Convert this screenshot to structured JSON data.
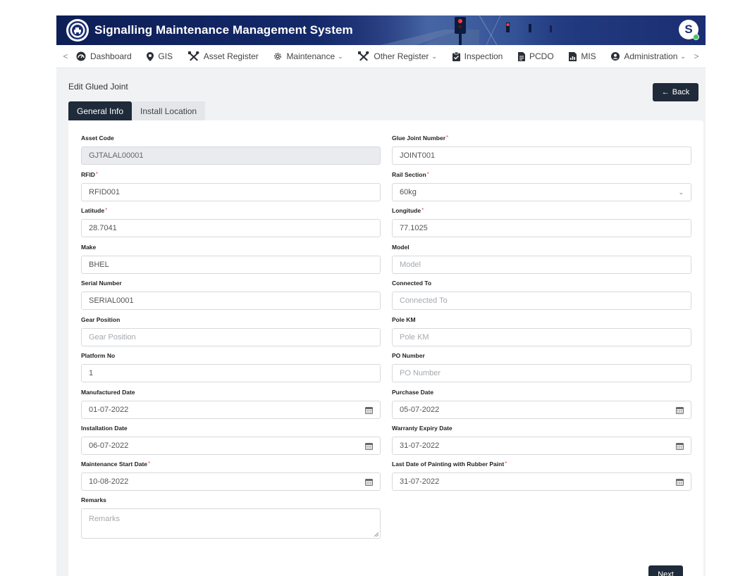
{
  "app": {
    "title": "Signalling Maintenance Management System",
    "avatar_initial": "S"
  },
  "nav": {
    "prev_arrow": "<",
    "next_arrow": ">",
    "items": [
      {
        "label": "Dashboard",
        "icon": "dashboard-gauge-icon",
        "dropdown": false
      },
      {
        "label": "GIS",
        "icon": "map-pin-icon",
        "dropdown": false
      },
      {
        "label": "Asset Register",
        "icon": "tools-icon",
        "dropdown": false
      },
      {
        "label": "Maintenance",
        "icon": "gear-icon",
        "dropdown": true
      },
      {
        "label": "Other Register",
        "icon": "tools-icon",
        "dropdown": true
      },
      {
        "label": "Inspection",
        "icon": "clipboard-check-icon",
        "dropdown": false
      },
      {
        "label": "PCDO",
        "icon": "document-icon",
        "dropdown": false
      },
      {
        "label": "MIS",
        "icon": "report-icon",
        "dropdown": false
      },
      {
        "label": "Administration",
        "icon": "user-circle-icon",
        "dropdown": true
      }
    ],
    "chevron": "⌄"
  },
  "page": {
    "title": "Edit Glued Joint",
    "back_label": "Back",
    "back_arrow": "←",
    "tabs": [
      {
        "label": "General Info",
        "active": true
      },
      {
        "label": "Install Location",
        "active": false
      }
    ],
    "next_label": "Next"
  },
  "form": {
    "asset_code": {
      "label": "Asset Code",
      "value": "GJTALAL00001",
      "placeholder": "",
      "required": false
    },
    "glue_joint_number": {
      "label": "Glue Joint Number",
      "value": "JOINT001",
      "placeholder": "",
      "required": true
    },
    "rfid": {
      "label": "RFID",
      "value": "RFID001",
      "placeholder": "",
      "required": true
    },
    "rail_section": {
      "label": "Rail Section",
      "value": "60kg",
      "placeholder": "",
      "required": true
    },
    "latitude": {
      "label": "Latitude",
      "value": "28.7041",
      "placeholder": "",
      "required": true
    },
    "longitude": {
      "label": "Longitude",
      "value": "77.1025",
      "placeholder": "",
      "required": true
    },
    "make": {
      "label": "Make",
      "value": "BHEL",
      "placeholder": "",
      "required": false
    },
    "model": {
      "label": "Model",
      "value": "",
      "placeholder": "Model",
      "required": false
    },
    "serial_number": {
      "label": "Serial Number",
      "value": "SERIAL0001",
      "placeholder": "",
      "required": false
    },
    "connected_to": {
      "label": "Connected To",
      "value": "",
      "placeholder": "Connected To",
      "required": false
    },
    "gear_position": {
      "label": "Gear Position",
      "value": "",
      "placeholder": "Gear Position",
      "required": false
    },
    "pole_km": {
      "label": "Pole KM",
      "value": "",
      "placeholder": "Pole KM",
      "required": false
    },
    "platform_no": {
      "label": "Platform No",
      "value": "1",
      "placeholder": "",
      "required": false
    },
    "po_number": {
      "label": "PO Number",
      "value": "",
      "placeholder": "PO Number",
      "required": false
    },
    "manufactured_date": {
      "label": "Manufactured Date",
      "value": "01-07-2022",
      "placeholder": "",
      "required": false
    },
    "purchase_date": {
      "label": "Purchase Date",
      "value": "05-07-2022",
      "placeholder": "",
      "required": false
    },
    "installation_date": {
      "label": "Installation Date",
      "value": "06-07-2022",
      "placeholder": "",
      "required": false
    },
    "warranty_expiry_date": {
      "label": "Warranty Expiry Date",
      "value": "31-07-2022",
      "placeholder": "",
      "required": false
    },
    "maintenance_start_date": {
      "label": "Maintenance Start Date",
      "value": "10-08-2022",
      "placeholder": "",
      "required": true
    },
    "last_painting_date": {
      "label": "Last Date of Painting with Rubber Paint",
      "value": "31-07-2022",
      "placeholder": "",
      "required": true
    },
    "remarks": {
      "label": "Remarks",
      "value": "",
      "placeholder": "Remarks",
      "required": false
    }
  },
  "colors": {
    "header_bg": "#14296a",
    "dark_button": "#1f2b3a",
    "required_mark": "#e05050",
    "status_online": "#44c767",
    "page_bg": "#f1f2f4"
  }
}
